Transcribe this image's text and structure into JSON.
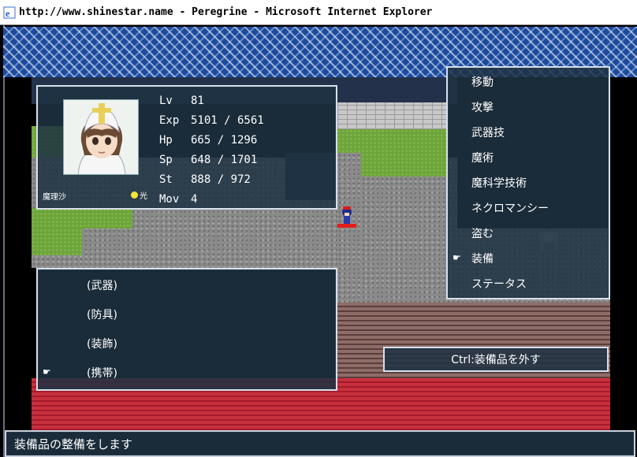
{
  "window": {
    "title": "http://www.shinestar.name - Peregrine - Microsoft Internet Explorer",
    "icon": "ie-icon"
  },
  "status": {
    "character_name": "魔理沙",
    "element_label": "光",
    "element_color": "#f2e63a",
    "stats": [
      {
        "label": "Lv",
        "value": "81"
      },
      {
        "label": "Exp",
        "value": "5101 / 6561"
      },
      {
        "label": "Hp",
        "value": "665 / 1296"
      },
      {
        "label": "Sp",
        "value": "648 / 1701"
      },
      {
        "label": "St",
        "value": "888 / 972"
      },
      {
        "label": "Mov",
        "value": "4"
      }
    ]
  },
  "equipment": {
    "items": [
      {
        "label": "(武器)"
      },
      {
        "label": "(防具)"
      },
      {
        "label": "(装飾)"
      },
      {
        "label": "(携帯)"
      }
    ],
    "selected_index": 3
  },
  "commands": {
    "items": [
      {
        "label": "移動"
      },
      {
        "label": "攻撃"
      },
      {
        "label": "武器技"
      },
      {
        "label": "魔術"
      },
      {
        "label": "魔科学技術"
      },
      {
        "label": "ネクロマンシー"
      },
      {
        "label": "盗む"
      },
      {
        "label": "装備"
      },
      {
        "label": "ステータス"
      }
    ],
    "selected_index": 7
  },
  "hint": {
    "text": "Ctrl:装備品を外す"
  },
  "message": {
    "text": "装備品の整備をします"
  },
  "colors": {
    "window_bg": "#1e3242",
    "window_border": "#d8e0ea",
    "text": "#ffffff"
  }
}
